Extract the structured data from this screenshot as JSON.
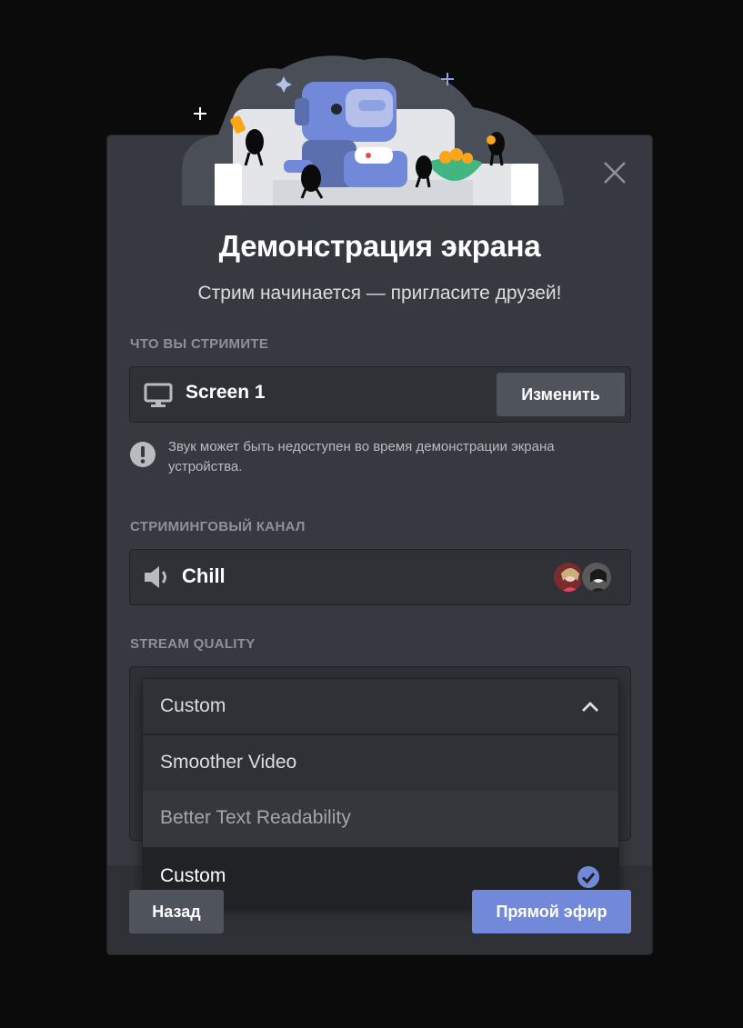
{
  "modal": {
    "title": "Демонстрация экрана",
    "subtitle": "Стрим начинается — пригласите друзей!"
  },
  "source": {
    "section_label": "Что вы стримите",
    "screen_label": "Screen 1",
    "change_button": "Изменить",
    "warning": "Звук может быть недоступен во время демонстрации экрана устройства."
  },
  "channel": {
    "section_label": "Стриминговый канал",
    "name": "Chill"
  },
  "quality": {
    "section_label": "Stream Quality",
    "selected": "Custom",
    "options": [
      {
        "label": "Smoother Video"
      },
      {
        "label": "Better Text Readability"
      },
      {
        "label": "Custom"
      }
    ]
  },
  "footer": {
    "back_button": "Назад",
    "go_live_button": "Прямой эфир"
  },
  "colors": {
    "accent": "#7289da",
    "modal_bg": "#36393f",
    "secondary_button": "#4f545c"
  },
  "icons": [
    "close-icon",
    "monitor-icon",
    "warning-icon",
    "speaker-icon",
    "chevron-up-icon",
    "check-circle-icon"
  ]
}
